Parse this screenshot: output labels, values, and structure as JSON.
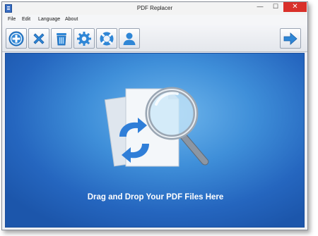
{
  "window": {
    "title": "PDF Replacer",
    "min_glyph": "—",
    "max_glyph": "☐",
    "close_glyph": "✕"
  },
  "menu": [
    "File",
    "Edit",
    "Language",
    "About"
  ],
  "toolbar": {
    "buttons": [
      {
        "name": "add-button",
        "icon": "add-icon"
      },
      {
        "name": "remove-button",
        "icon": "close-icon"
      },
      {
        "name": "clear-button",
        "icon": "trash-icon"
      },
      {
        "name": "settings-button",
        "icon": "gear-icon"
      },
      {
        "name": "help-button",
        "icon": "lifebuoy-icon"
      },
      {
        "name": "account-button",
        "icon": "user-icon"
      },
      {
        "name": "next-button",
        "icon": "arrow-right-icon"
      }
    ]
  },
  "dropzone": {
    "text": "Drag and Drop Your PDF Files Here"
  },
  "colors": {
    "accent_blue": "#2f7ed8",
    "dropzone_center": "#6fb6ec",
    "dropzone_edge": "#1c56ab",
    "close_red": "#d9302a"
  }
}
